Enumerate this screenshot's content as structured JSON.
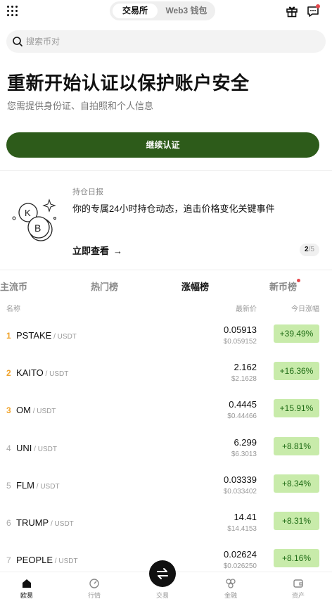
{
  "header": {
    "tabs": [
      {
        "label": "交易所",
        "active": true
      },
      {
        "label": "Web3 钱包",
        "active": false
      }
    ],
    "icons": [
      "grid-menu-icon",
      "gift-icon",
      "message-icon"
    ]
  },
  "search": {
    "placeholder": "搜索币对"
  },
  "hero": {
    "title": "重新开始认证以保护账户安全",
    "subtitle": "您需提供身份证、自拍照和个人信息",
    "button_label": "继续认证",
    "button_color": "#2d5b1a"
  },
  "card": {
    "tag": "持仓日报",
    "text": "你的专属24小时持仓动态，追击价格变化关键事件",
    "link_label": "立即查看",
    "pager_current": "2",
    "pager_total": "/5"
  },
  "market": {
    "tabs": [
      {
        "label": "主流币",
        "active": false
      },
      {
        "label": "热门榜",
        "active": false
      },
      {
        "label": "涨幅榜",
        "active": true
      },
      {
        "label": "新币榜",
        "active": false,
        "badge": true
      }
    ],
    "columns": {
      "name": "名称",
      "price": "最新价",
      "change": "今日涨幅"
    },
    "rows": [
      {
        "rank": "1",
        "base": "PSTAKE",
        "quote": " / USDT",
        "price": "0.05913",
        "fiat": "$0.059152",
        "change": "+39.49%"
      },
      {
        "rank": "2",
        "base": "KAITO",
        "quote": " / USDT",
        "price": "2.162",
        "fiat": "$2.1628",
        "change": "+16.36%"
      },
      {
        "rank": "3",
        "base": "OM",
        "quote": " / USDT",
        "price": "0.4445",
        "fiat": "$0.44466",
        "change": "+15.91%"
      },
      {
        "rank": "4",
        "base": "UNI",
        "quote": " / USDT",
        "price": "6.299",
        "fiat": "$6.3013",
        "change": "+8.81%"
      },
      {
        "rank": "5",
        "base": "FLM",
        "quote": " / USDT",
        "price": "0.03339",
        "fiat": "$0.033402",
        "change": "+8.34%"
      },
      {
        "rank": "6",
        "base": "TRUMP",
        "quote": " / USDT",
        "price": "14.41",
        "fiat": "$14.4153",
        "change": "+8.31%"
      },
      {
        "rank": "7",
        "base": "PEOPLE",
        "quote": " / USDT",
        "price": "0.02624",
        "fiat": "$0.026250",
        "change": "+8.16%"
      }
    ],
    "up_color": "#c8ebaa",
    "rank_top_color": "#f0a32b"
  },
  "bottom_nav": [
    {
      "label": "欧易",
      "icon": "home-icon",
      "active": true
    },
    {
      "label": "行情",
      "icon": "market-icon",
      "active": false
    },
    {
      "label": "交易",
      "icon": "trade-swap-icon",
      "active": false
    },
    {
      "label": "金融",
      "icon": "finance-icon",
      "active": false
    },
    {
      "label": "资产",
      "icon": "wallet-icon",
      "active": false
    }
  ]
}
